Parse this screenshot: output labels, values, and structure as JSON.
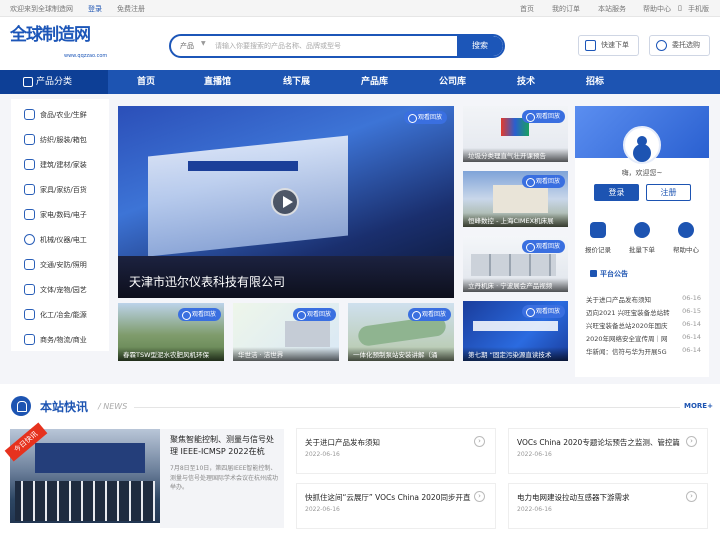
{
  "topbar": {
    "welcome": "欢迎来到全球制造网",
    "login": "登录",
    "register": "免费注册",
    "links": [
      "首页",
      "我的订单",
      "本站服务",
      "帮助中心",
      "手机版"
    ]
  },
  "header": {
    "logo": "全球制造网",
    "logo_url": "www.qqzzao.com",
    "search_category": "产品",
    "search_placeholder": "请输入你要搜索的产品名称、品牌或型号",
    "search_button": "搜索",
    "btn_quick_order": "快速下单",
    "btn_delegate_buy": "委托选购"
  },
  "nav": {
    "category": "产品分类",
    "items": [
      "首页",
      "直播馆",
      "线下展",
      "产品库",
      "公司库",
      "技术",
      "招标"
    ]
  },
  "sidebar": {
    "items": [
      {
        "label": "食品/农业/生鲜",
        "icon": "leaf-icon"
      },
      {
        "label": "纺织/服装/箱包",
        "icon": "shirt-icon"
      },
      {
        "label": "建筑/建材/家装",
        "icon": "building-icon"
      },
      {
        "label": "家具/家纺/百货",
        "icon": "sofa-icon"
      },
      {
        "label": "家电/数码/电子",
        "icon": "plug-icon"
      },
      {
        "label": "机械/仪器/电工",
        "icon": "gear-icon"
      },
      {
        "label": "交通/安防/照明",
        "icon": "car-icon"
      },
      {
        "label": "文体/宠物/园艺",
        "icon": "book-icon"
      },
      {
        "label": "化工/冶金/能源",
        "icon": "flask-icon"
      },
      {
        "label": "商务/物流/商业",
        "icon": "briefcase-icon"
      }
    ]
  },
  "badge_label": "观看回放",
  "hero": {
    "title": "天津市迅尔仪表科技有限公司"
  },
  "right_thumbs": [
    {
      "caption": "垃圾分类理直气壮开课预告"
    },
    {
      "caption": "恒峰数控 - 上海CIMEX机床展"
    },
    {
      "caption": "立丹机床 · 宁波展会产品视频"
    },
    {
      "caption": "第七期 “固定污染源直读技术"
    }
  ],
  "bottom_thumbs": [
    {
      "caption": "春霖TSW型泥水农肥风机环保"
    },
    {
      "caption": "华世洁 · 洁世界"
    },
    {
      "caption": "一体化预制泵站安装讲解（涌"
    }
  ],
  "user": {
    "greeting": "嗨，欢迎您~",
    "login": "登录",
    "register": "注册",
    "actions": [
      {
        "label": "报价记录",
        "icon": "document-icon"
      },
      {
        "label": "批量下单",
        "icon": "check-icon"
      },
      {
        "label": "帮助中心",
        "icon": "question-icon"
      }
    ],
    "announcement_title": "平台公告",
    "news": [
      {
        "title": "关于进口产品发布须知",
        "date": "06-16"
      },
      {
        "title": "迈向2021 兴旺宝装备总站转",
        "date": "06-15"
      },
      {
        "title": "兴旺宝装备总站2020年国庆",
        "date": "06-14"
      },
      {
        "title": "2020年网络安全宣传周｜网",
        "date": "06-14"
      },
      {
        "title": "华新闻：信符与华为开展5G",
        "date": "06-14"
      }
    ]
  },
  "news_section": {
    "title": "本站快讯",
    "subtitle": "/ NEWS",
    "more": "MORE+",
    "ribbon": "今日快讯",
    "featured_title": "聚焦智能控制、测量与信号处理 IEEE-ICMSP 2022在杭",
    "featured_desc": "7月8日至10日，第四届IEEE智能控制、测量与信号处理国际学术会议在杭州成功举办。",
    "cards": [
      {
        "title": "关于进口产品发布须知",
        "date": "2022-06-16"
      },
      {
        "title": "VOCs China 2020专题论坛预告之监测、管控篇",
        "date": "2022-06-16"
      },
      {
        "title": "快抓住这间“云展厅” VOCs China 2020同步开直",
        "date": "2022-06-16"
      },
      {
        "title": "电力电网建设拉动互感器下游需求",
        "date": "2022-06-16"
      }
    ]
  },
  "colors": {
    "brand": "#1d54b2",
    "badge": "#3a6fe0",
    "ribbon": "#e6321e"
  }
}
